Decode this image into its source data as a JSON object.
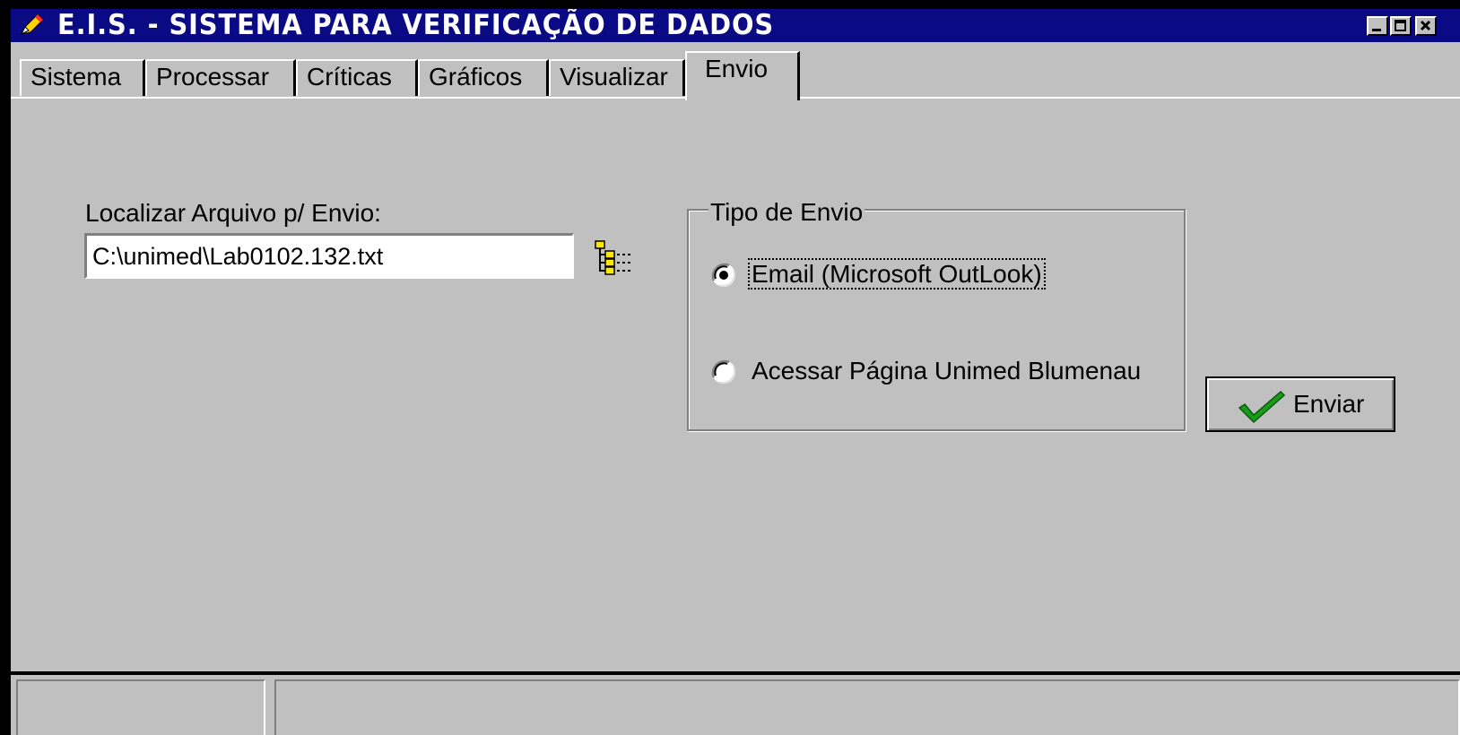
{
  "window": {
    "title": "E.I.S. - SISTEMA PARA VERIFICAÇÃO DE DADOS",
    "icon": "pencil-icon",
    "controls": [
      "minimize-icon",
      "maximize-icon",
      "close-icon"
    ]
  },
  "tabs": [
    {
      "label": "Sistema",
      "active": false
    },
    {
      "label": "Processar",
      "active": false
    },
    {
      "label": "Críticas",
      "active": false
    },
    {
      "label": "Gráficos",
      "active": false
    },
    {
      "label": "Visualizar",
      "active": false
    },
    {
      "label": "Envio",
      "active": true
    }
  ],
  "file_section": {
    "label": "Localizar Arquivo p/ Envio:",
    "value": "C:\\unimed\\Lab0102.132.txt",
    "browse_icon": "folder-tree-icon"
  },
  "send_type": {
    "legend": "Tipo de Envio",
    "options": [
      {
        "label": "Email (Microsoft OutLook)",
        "selected": true
      },
      {
        "label": "Acessar Página Unimed Blumenau",
        "selected": false
      }
    ]
  },
  "send_button": {
    "label": "Enviar",
    "icon": "checkmark-icon"
  },
  "colors": {
    "titlebar": "#0a0a84",
    "face": "#c0c0c0",
    "check": "#1a9a1a"
  }
}
